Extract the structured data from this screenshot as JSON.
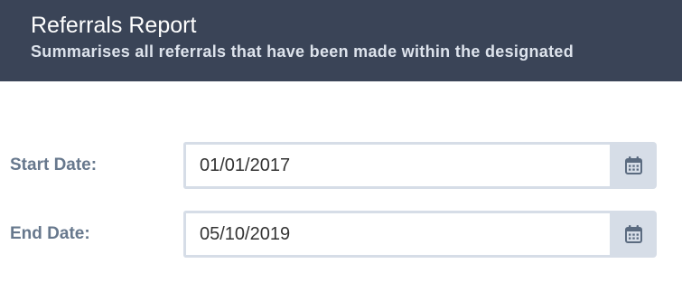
{
  "header": {
    "title": "Referrals Report",
    "subtitle": "Summarises all referrals that have been made within the designated"
  },
  "form": {
    "start_date": {
      "label": "Start Date:",
      "value": "01/01/2017",
      "icon": "calendar-icon"
    },
    "end_date": {
      "label": "End Date:",
      "value": "05/10/2019",
      "icon": "calendar-icon"
    }
  },
  "colors": {
    "header_background": "#3a4457",
    "label_text": "#67788d",
    "input_border": "#d6dde7",
    "icon": "#5b6b80"
  }
}
